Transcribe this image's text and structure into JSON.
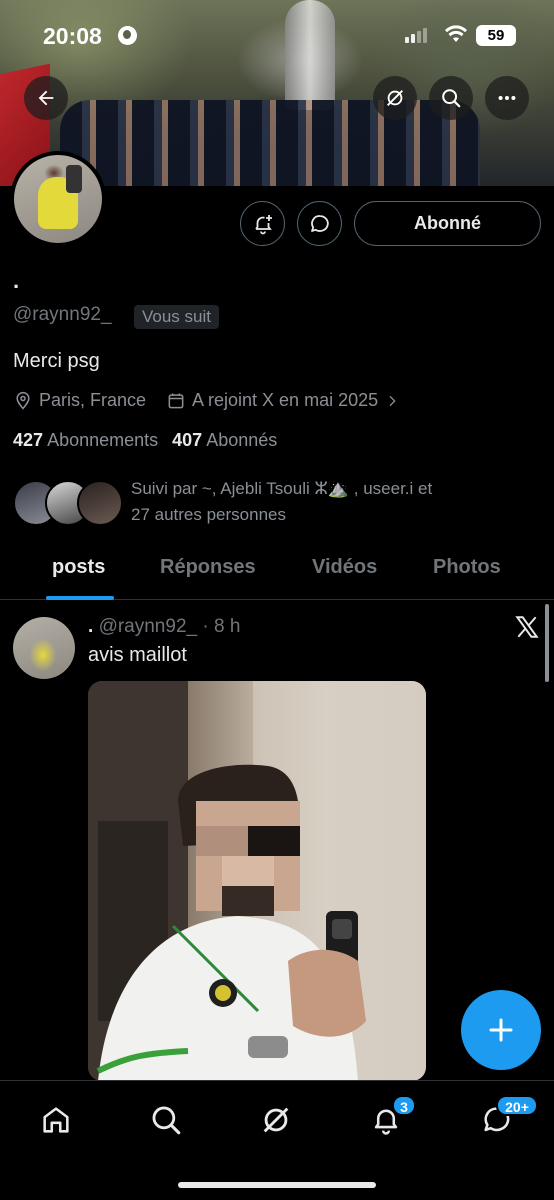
{
  "status_bar": {
    "time": "20:08",
    "battery": "59"
  },
  "profile": {
    "display_name": ".",
    "handle": "@raynn92_",
    "follows_you": "Vous suit",
    "bio": "Merci psg",
    "location": "Paris, France",
    "joined": "A rejoint X en mai 2025",
    "following_count": "427",
    "following_label": "Abonnements",
    "followers_count": "407",
    "followers_label": "Abonnés",
    "followed_by_line1": "Suivi par ~, Ajebli Tsouli ⵣ⛰️ , useer.i et",
    "followed_by_line2": "27 autres personnes",
    "follow_button": "Abonné"
  },
  "tabs": [
    {
      "label": "posts",
      "active": true
    },
    {
      "label": "Réponses",
      "active": false
    },
    {
      "label": "Vidéos",
      "active": false
    },
    {
      "label": "Photos",
      "active": false
    }
  ],
  "post": {
    "name": ".",
    "handle": "@raynn92_",
    "separator": "·",
    "time": "8 h",
    "text": "avis maillot"
  },
  "nav": {
    "notifications_badge": "3",
    "messages_badge": "20+"
  },
  "colors": {
    "accent": "#1d9bf0",
    "background": "#000000",
    "muted_text": "#71767b"
  },
  "icons": [
    "back-arrow-icon",
    "grok-icon",
    "search-icon",
    "more-icon",
    "notification-plus-icon",
    "message-icon",
    "location-icon",
    "calendar-icon",
    "chevron-right-icon",
    "x-logo-icon",
    "plus-icon",
    "home-icon",
    "bell-icon",
    "envelope-icon"
  ]
}
